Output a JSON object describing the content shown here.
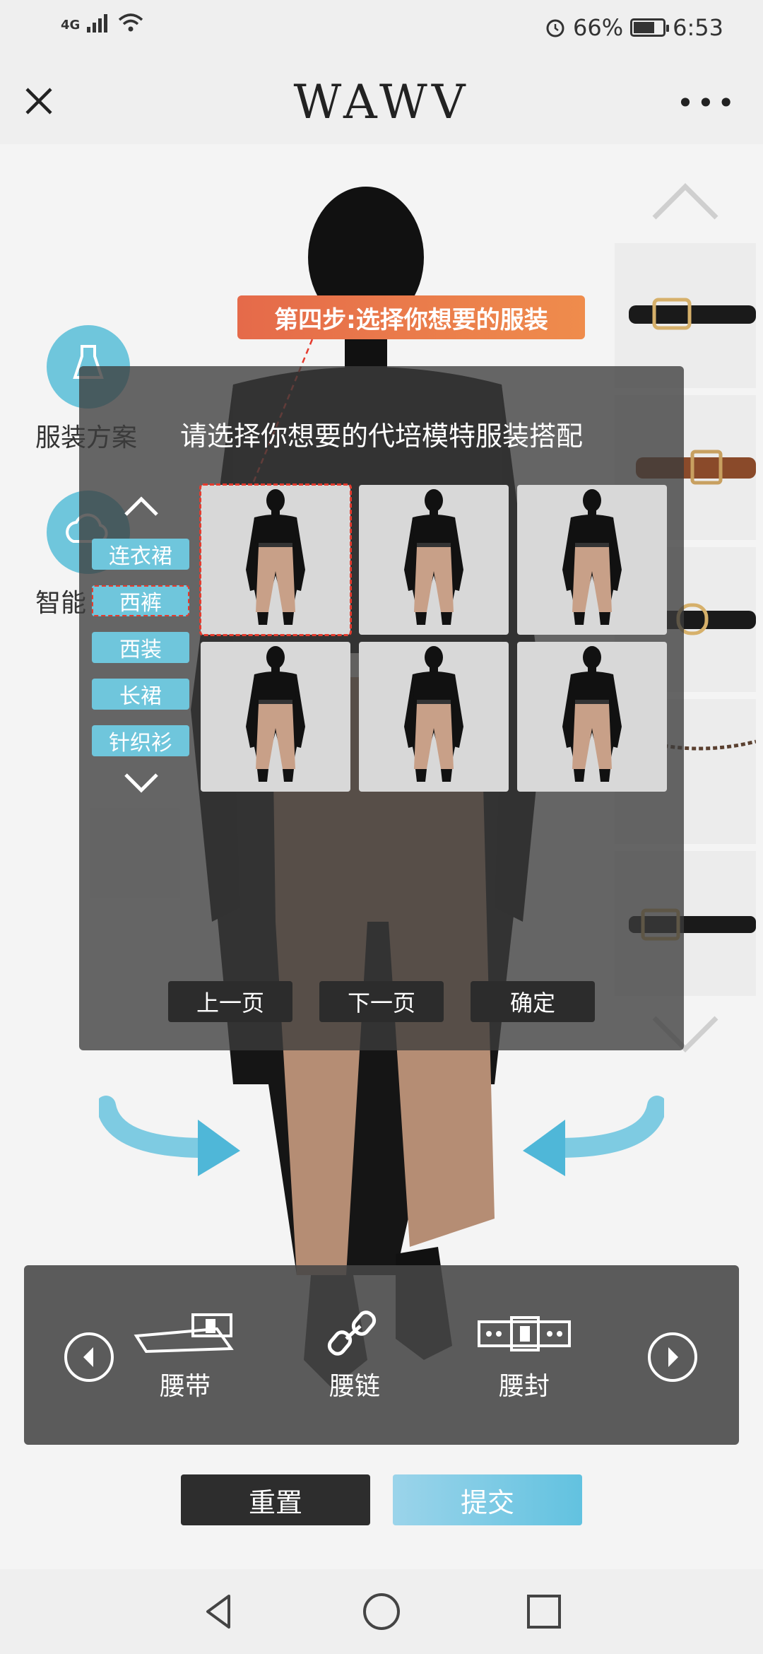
{
  "status_bar": {
    "network": "4G",
    "battery": "66%",
    "battery_level": 0.66,
    "time": "6:53",
    "icons": [
      "signal-icon",
      "wifi-icon",
      "alarm-icon",
      "battery-icon"
    ]
  },
  "header": {
    "brand": "WAWV",
    "close_icon": "close-icon",
    "more_icon": "more-icon"
  },
  "left_menu": {
    "items": [
      {
        "label": "服装方案",
        "icon": "dress-icon"
      },
      {
        "label": "智能",
        "icon": "cloud-icon"
      }
    ]
  },
  "step_banner": "第四步:选择你想要的服装",
  "modal": {
    "title": "请选择你想要的代培模特服装搭配",
    "categories": [
      {
        "label": "连衣裙",
        "active": false
      },
      {
        "label": "西裤",
        "active": true
      },
      {
        "label": "西装",
        "active": false
      },
      {
        "label": "长裙",
        "active": false
      },
      {
        "label": "针织衫",
        "active": false
      }
    ],
    "selected_index": 0,
    "outfit_count": 6,
    "buttons": {
      "prev": "上一页",
      "next": "下一页",
      "confirm": "确定"
    }
  },
  "accessories": {
    "items": [
      {
        "label": "腰带",
        "icon": "belt-icon"
      },
      {
        "label": "腰链",
        "icon": "chain-icon"
      },
      {
        "label": "腰封",
        "icon": "waist-seal-icon"
      }
    ]
  },
  "actions": {
    "reset": "重置",
    "submit": "提交"
  },
  "colors": {
    "accent": "#6fc6dc",
    "banner": "#e56a4a",
    "highlight": "#e53b2e"
  }
}
